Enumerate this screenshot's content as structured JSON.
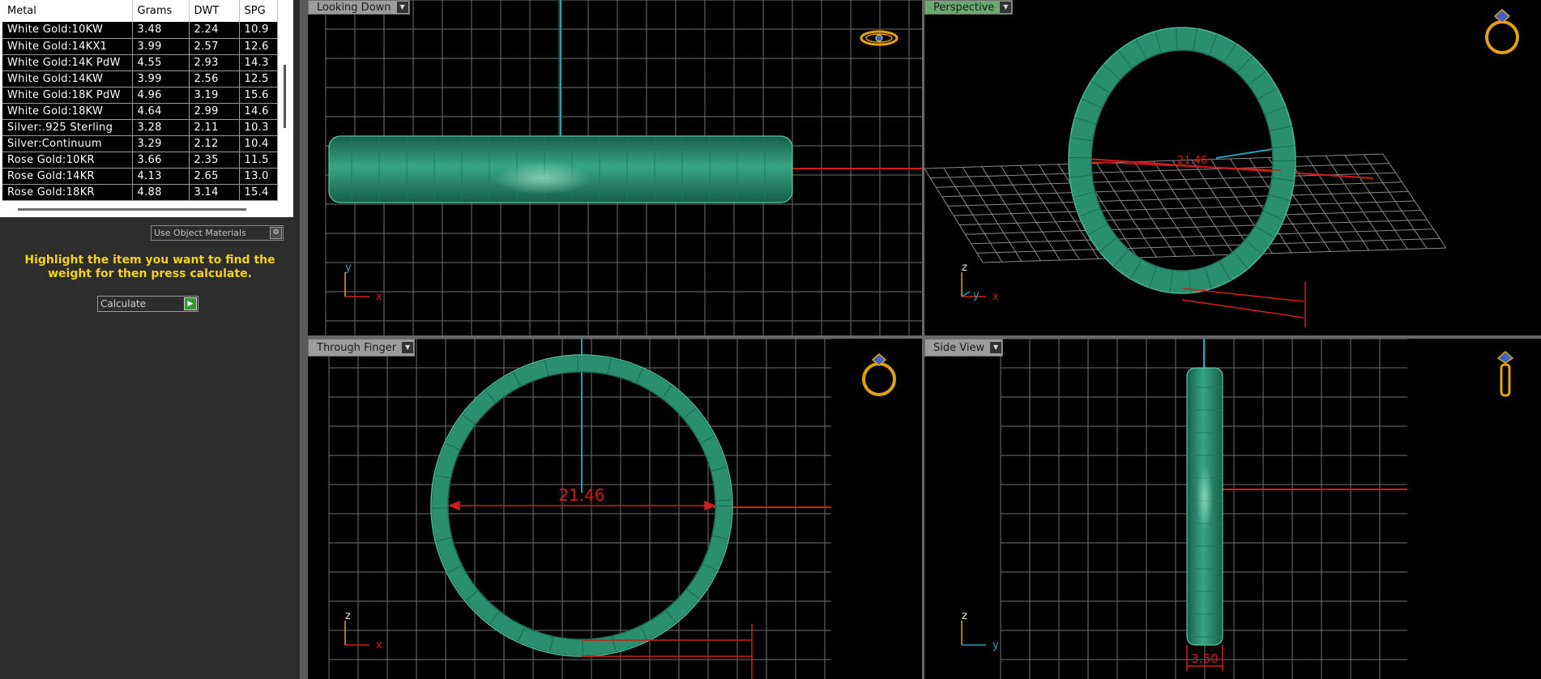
{
  "table": {
    "headers": [
      "Metal",
      "Grams",
      "DWT",
      "SPG"
    ],
    "rows": [
      [
        "White Gold:10KW",
        "3.48",
        "2.24",
        "10.9"
      ],
      [
        "White Gold:14KX1",
        "3.99",
        "2.57",
        "12.6"
      ],
      [
        "White Gold:14K PdW",
        "4.55",
        "2.93",
        "14.3"
      ],
      [
        "White Gold:14KW",
        "3.99",
        "2.56",
        "12.5"
      ],
      [
        "White Gold:18K PdW",
        "4.96",
        "3.19",
        "15.6"
      ],
      [
        "White Gold:18KW",
        "4.64",
        "2.99",
        "14.6"
      ],
      [
        "Silver:.925 Sterling",
        "3.28",
        "2.11",
        "10.3"
      ],
      [
        "Silver:Continuum",
        "3.29",
        "2.12",
        "10.4"
      ],
      [
        "Rose Gold:10KR",
        "3.66",
        "2.35",
        "11.5"
      ],
      [
        "Rose Gold:14KR",
        "4.13",
        "2.65",
        "13.0"
      ],
      [
        "Rose Gold:18KR",
        "4.88",
        "3.14",
        "15.4"
      ]
    ]
  },
  "options": {
    "use_object_materials": "Use Object Materials"
  },
  "instruction": "Highlight the item you want to find the weight for then press calculate.",
  "calculate_label": "Calculate",
  "viewports": {
    "top": {
      "label": "Looking Down"
    },
    "persp": {
      "label": "Perspective",
      "dimension": "21.46"
    },
    "front": {
      "label": "Through Finger",
      "dimension": "21.46"
    },
    "side": {
      "label": "Side View",
      "dimension": "3.50"
    }
  },
  "axes": {
    "x": "x",
    "y": "y",
    "z": "z"
  },
  "icons": {
    "view_cube": "ring-navigation-icon",
    "dropdown": "chevron-down-icon",
    "calculate": "play-arrow-icon"
  },
  "colors": {
    "ring": "#2a8f6e",
    "ring_light": "#3fb48c",
    "grid": "#8a8a8a",
    "axis_cyan": "#1fa5b5",
    "axis_red": "#d21c1c",
    "accent_yellow": "#f5d21c",
    "icon_gold": "#e2a20c",
    "active_view": "#6aa86e"
  }
}
